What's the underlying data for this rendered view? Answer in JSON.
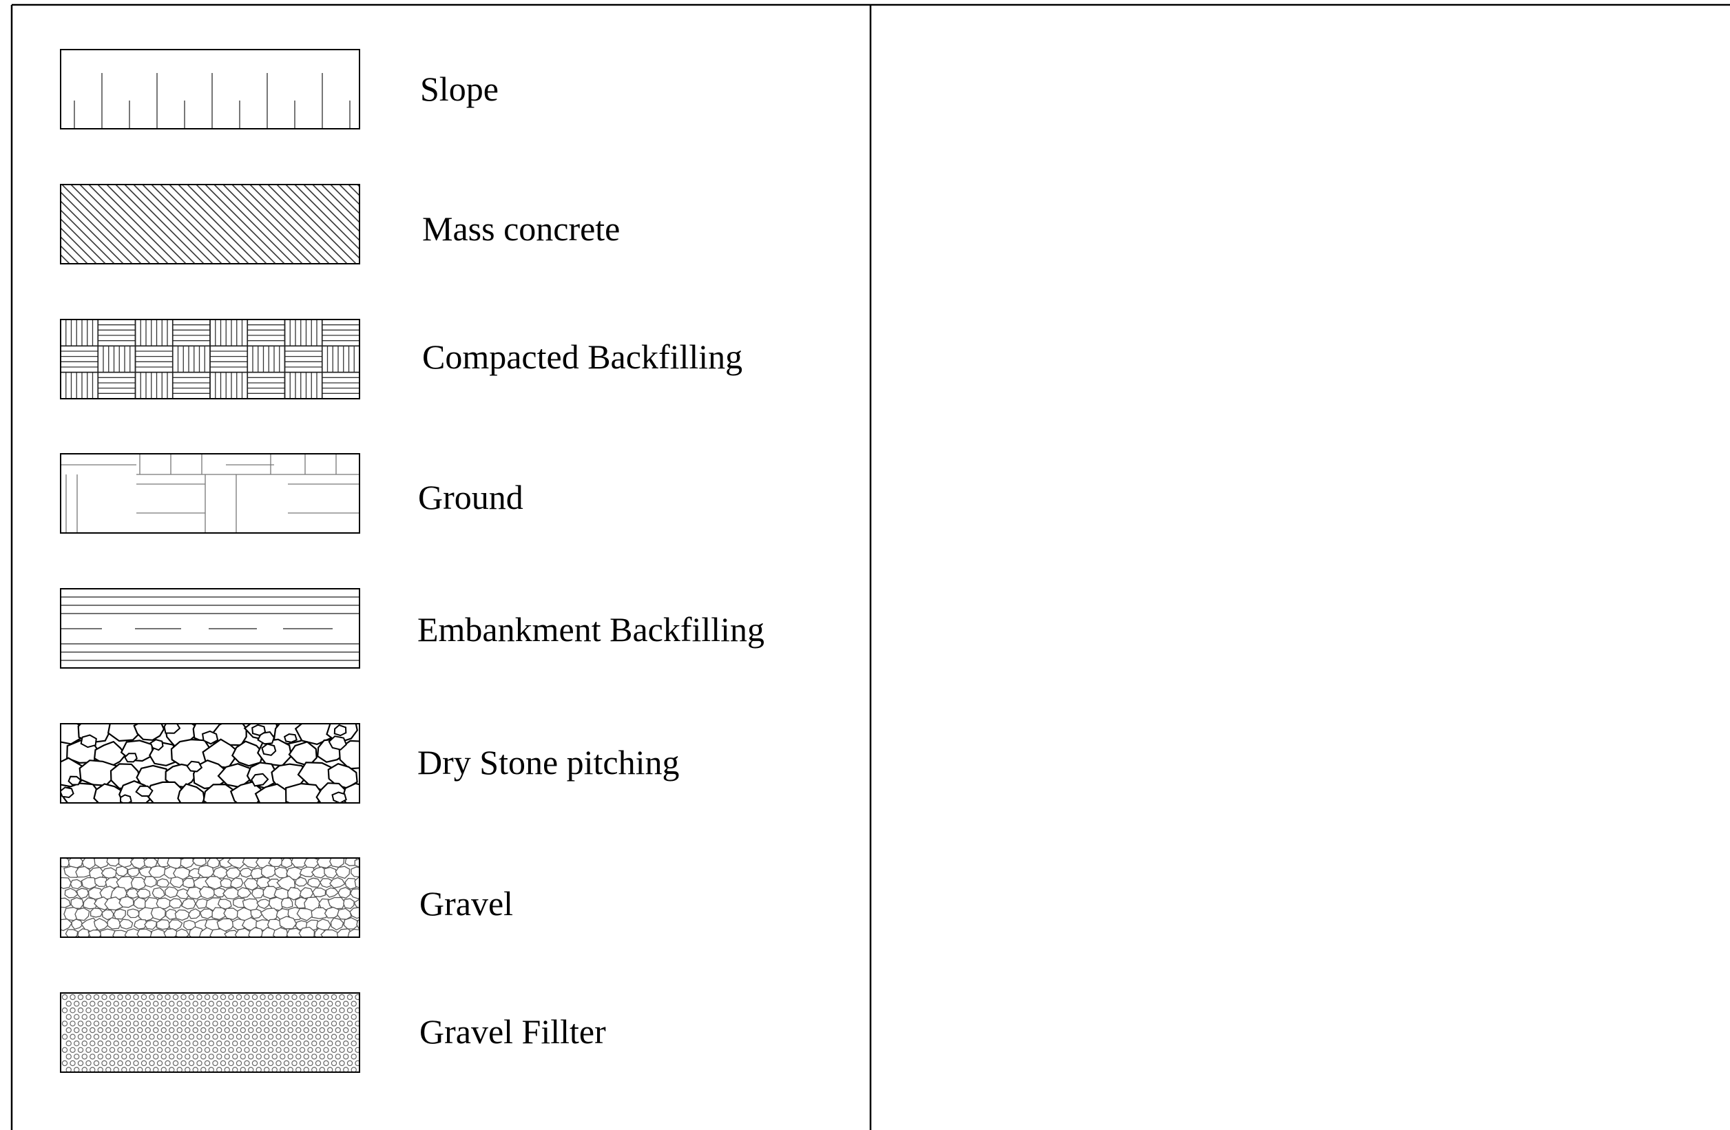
{
  "legend": {
    "items": [
      {
        "key": "slope",
        "label": "Slope",
        "pattern": "slope"
      },
      {
        "key": "mass-concrete",
        "label": "Mass concrete",
        "pattern": "diagonal-hatch"
      },
      {
        "key": "compacted-backfilling",
        "label": "Compacted Backfilling",
        "pattern": "basket-weave"
      },
      {
        "key": "ground",
        "label": "Ground",
        "pattern": "ground"
      },
      {
        "key": "embankment-backfilling",
        "label": "Embankment Backfilling",
        "pattern": "horizontal-lines-dashes"
      },
      {
        "key": "dry-stone-pitching",
        "label": "Dry Stone pitching",
        "pattern": "large-stones"
      },
      {
        "key": "gravel",
        "label": "Gravel",
        "pattern": "small-stones"
      },
      {
        "key": "gravel-fillter",
        "label": "Gravel Fillter",
        "pattern": "small-circles"
      }
    ]
  },
  "colors": {
    "line": "#000000",
    "fine_line": "#555555",
    "background": "#ffffff"
  }
}
